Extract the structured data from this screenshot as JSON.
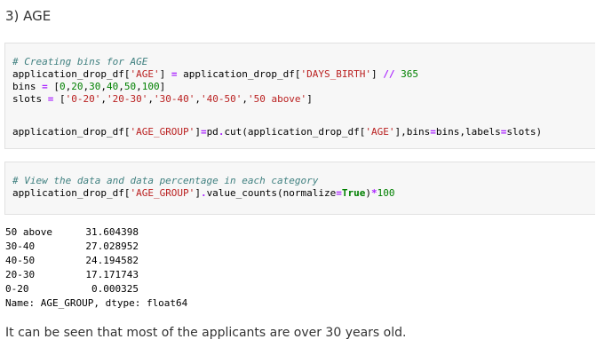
{
  "heading": "3) AGE",
  "cell1": {
    "comment": "# Creating bins for AGE",
    "line2": {
      "a": "application_drop_df[",
      "b": "'AGE'",
      "c": "] ",
      "d": "=",
      "e": " application_drop_df[",
      "f": "'DAYS_BIRTH'",
      "g": "] ",
      "h": "//",
      "i": " ",
      "j": "365"
    },
    "line3": {
      "a": "bins ",
      "b": "=",
      "c": " [",
      "d": "0",
      "e": ",",
      "f": "20",
      "g": ",",
      "h": "30",
      "i": ",",
      "j": "40",
      "k": ",",
      "l": "50",
      "m": ",",
      "n": "100",
      "o": "]"
    },
    "line4": {
      "a": "slots ",
      "b": "=",
      "c": " [",
      "d": "'0-20'",
      "e": ",",
      "f": "'20-30'",
      "g": ",",
      "h": "'30-40'",
      "i": ",",
      "j": "'40-50'",
      "k": ",",
      "l": "'50 above'",
      "m": "]"
    },
    "line6": {
      "a": "application_drop_df[",
      "b": "'AGE_GROUP'",
      "c": "]",
      "d": "=",
      "e": "pd",
      "f": ".",
      "g": "cut(application_drop_df[",
      "h": "'AGE'",
      "i": "],bins",
      "j": "=",
      "k": "bins,labels",
      "l": "=",
      "m": "slots)"
    }
  },
  "cell2": {
    "comment": "# View the data and data percentage in each category",
    "line2": {
      "a": "application_drop_df[",
      "b": "'AGE_GROUP'",
      "c": "]",
      "d": ".",
      "e": "value_counts(normalize",
      "f": "=",
      "g": "True",
      "h": ")",
      "i": "*",
      "j": "100"
    }
  },
  "output": {
    "rows": [
      {
        "label": "50 above",
        "value": "31.604398"
      },
      {
        "label": "30-40",
        "value": "27.028952"
      },
      {
        "label": "40-50",
        "value": "24.194582"
      },
      {
        "label": "20-30",
        "value": "17.171743"
      },
      {
        "label": "0-20",
        "value": "0.000325"
      }
    ],
    "footer": "Name: AGE_GROUP, dtype: float64"
  },
  "conclusion": "It can be seen that most of the applicants are over 30 years old."
}
